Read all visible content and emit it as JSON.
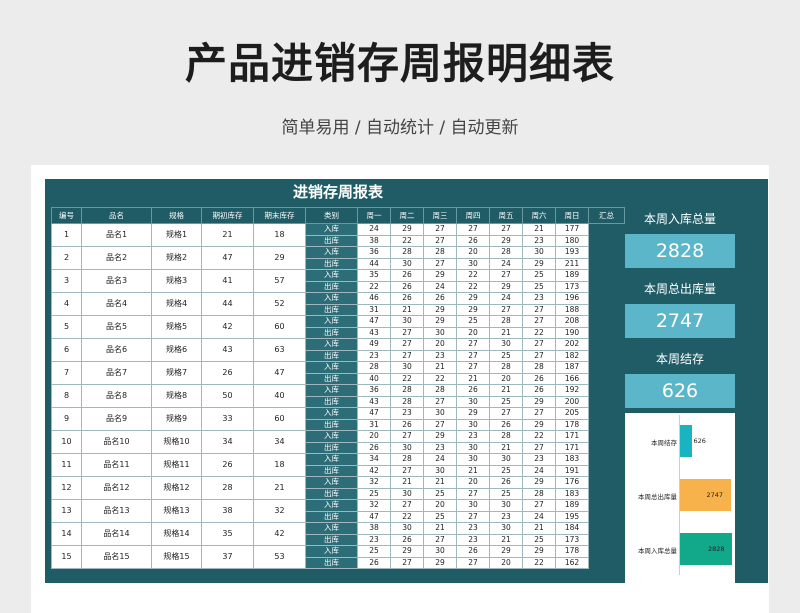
{
  "header": {
    "title": "产品进销存周报明细表",
    "subtitle": "简单易用 / 自动统计 / 自动更新"
  },
  "sheet": {
    "title": "进销存周报表",
    "columns": [
      "编号",
      "品名",
      "规格",
      "期初库存",
      "期末库存",
      "类别",
      "周一",
      "周二",
      "周三",
      "周四",
      "周五",
      "周六",
      "周日",
      "汇总"
    ],
    "kind_labels": {
      "in": "入库",
      "out": "出库"
    },
    "rows": [
      {
        "no": "1",
        "name": "品名1",
        "spec": "规格1",
        "start": "21",
        "end": "18",
        "in": [
          "24",
          "29",
          "27",
          "27",
          "27",
          "21",
          "177"
        ],
        "out": [
          "38",
          "22",
          "27",
          "26",
          "29",
          "23",
          "180"
        ]
      },
      {
        "no": "2",
        "name": "品名2",
        "spec": "规格2",
        "start": "47",
        "end": "29",
        "in": [
          "36",
          "28",
          "28",
          "20",
          "28",
          "30",
          "193"
        ],
        "out": [
          "44",
          "30",
          "27",
          "30",
          "24",
          "29",
          "211"
        ]
      },
      {
        "no": "3",
        "name": "品名3",
        "spec": "规格3",
        "start": "41",
        "end": "57",
        "in": [
          "35",
          "26",
          "29",
          "22",
          "27",
          "25",
          "189"
        ],
        "out": [
          "22",
          "26",
          "24",
          "22",
          "29",
          "25",
          "173"
        ]
      },
      {
        "no": "4",
        "name": "品名4",
        "spec": "规格4",
        "start": "44",
        "end": "52",
        "in": [
          "46",
          "26",
          "26",
          "29",
          "24",
          "23",
          "196"
        ],
        "out": [
          "31",
          "21",
          "29",
          "29",
          "27",
          "27",
          "188"
        ]
      },
      {
        "no": "5",
        "name": "品名5",
        "spec": "规格5",
        "start": "42",
        "end": "60",
        "in": [
          "47",
          "30",
          "29",
          "25",
          "28",
          "27",
          "208"
        ],
        "out": [
          "43",
          "27",
          "30",
          "20",
          "21",
          "22",
          "190"
        ]
      },
      {
        "no": "6",
        "name": "品名6",
        "spec": "规格6",
        "start": "43",
        "end": "63",
        "in": [
          "49",
          "27",
          "20",
          "27",
          "30",
          "27",
          "202"
        ],
        "out": [
          "23",
          "27",
          "23",
          "27",
          "25",
          "27",
          "182"
        ]
      },
      {
        "no": "7",
        "name": "品名7",
        "spec": "规格7",
        "start": "26",
        "end": "47",
        "in": [
          "28",
          "30",
          "21",
          "27",
          "28",
          "28",
          "187"
        ],
        "out": [
          "40",
          "22",
          "22",
          "21",
          "20",
          "26",
          "166"
        ]
      },
      {
        "no": "8",
        "name": "品名8",
        "spec": "规格8",
        "start": "50",
        "end": "40",
        "in": [
          "36",
          "28",
          "28",
          "26",
          "21",
          "26",
          "192"
        ],
        "out": [
          "43",
          "28",
          "27",
          "30",
          "25",
          "29",
          "200"
        ]
      },
      {
        "no": "9",
        "name": "品名9",
        "spec": "规格9",
        "start": "33",
        "end": "60",
        "in": [
          "47",
          "23",
          "30",
          "29",
          "27",
          "27",
          "205"
        ],
        "out": [
          "31",
          "26",
          "27",
          "30",
          "26",
          "29",
          "178"
        ]
      },
      {
        "no": "10",
        "name": "品名10",
        "spec": "规格10",
        "start": "34",
        "end": "34",
        "in": [
          "20",
          "27",
          "29",
          "23",
          "28",
          "22",
          "171"
        ],
        "out": [
          "26",
          "30",
          "23",
          "30",
          "21",
          "27",
          "171"
        ]
      },
      {
        "no": "11",
        "name": "品名11",
        "spec": "规格11",
        "start": "26",
        "end": "18",
        "in": [
          "34",
          "28",
          "24",
          "30",
          "30",
          "23",
          "183"
        ],
        "out": [
          "42",
          "27",
          "30",
          "21",
          "25",
          "24",
          "191"
        ]
      },
      {
        "no": "12",
        "name": "品名12",
        "spec": "规格12",
        "start": "28",
        "end": "21",
        "in": [
          "32",
          "21",
          "21",
          "20",
          "26",
          "29",
          "176"
        ],
        "out": [
          "25",
          "30",
          "25",
          "27",
          "25",
          "28",
          "183"
        ]
      },
      {
        "no": "13",
        "name": "品名13",
        "spec": "规格13",
        "start": "38",
        "end": "32",
        "in": [
          "32",
          "27",
          "20",
          "30",
          "30",
          "27",
          "189"
        ],
        "out": [
          "47",
          "22",
          "25",
          "27",
          "23",
          "24",
          "195"
        ]
      },
      {
        "no": "14",
        "name": "品名14",
        "spec": "规格14",
        "start": "35",
        "end": "42",
        "in": [
          "38",
          "30",
          "21",
          "23",
          "30",
          "21",
          "184"
        ],
        "out": [
          "23",
          "26",
          "27",
          "23",
          "21",
          "25",
          "173"
        ]
      },
      {
        "no": "15",
        "name": "品名15",
        "spec": "规格15",
        "start": "37",
        "end": "53",
        "in": [
          "25",
          "29",
          "30",
          "26",
          "29",
          "29",
          "178"
        ],
        "out": [
          "26",
          "27",
          "29",
          "27",
          "20",
          "22",
          "162"
        ]
      }
    ]
  },
  "summary": {
    "in_total_label": "本周入库总量",
    "in_total": "2828",
    "out_total_label": "本周总出库量",
    "out_total": "2747",
    "balance_label": "本周结存",
    "balance": "626"
  },
  "mini_chart": {
    "bars": [
      {
        "label": "本周结存",
        "value": 626,
        "value_text": "626",
        "color": "#19b3c2"
      },
      {
        "label": "本周总出库量",
        "value": 2747,
        "value_text": "2747",
        "color": "#f7b24c"
      },
      {
        "label": "本周入库总量",
        "value": 2828,
        "value_text": "2828",
        "color": "#12a88a"
      }
    ],
    "max": 2828
  }
}
